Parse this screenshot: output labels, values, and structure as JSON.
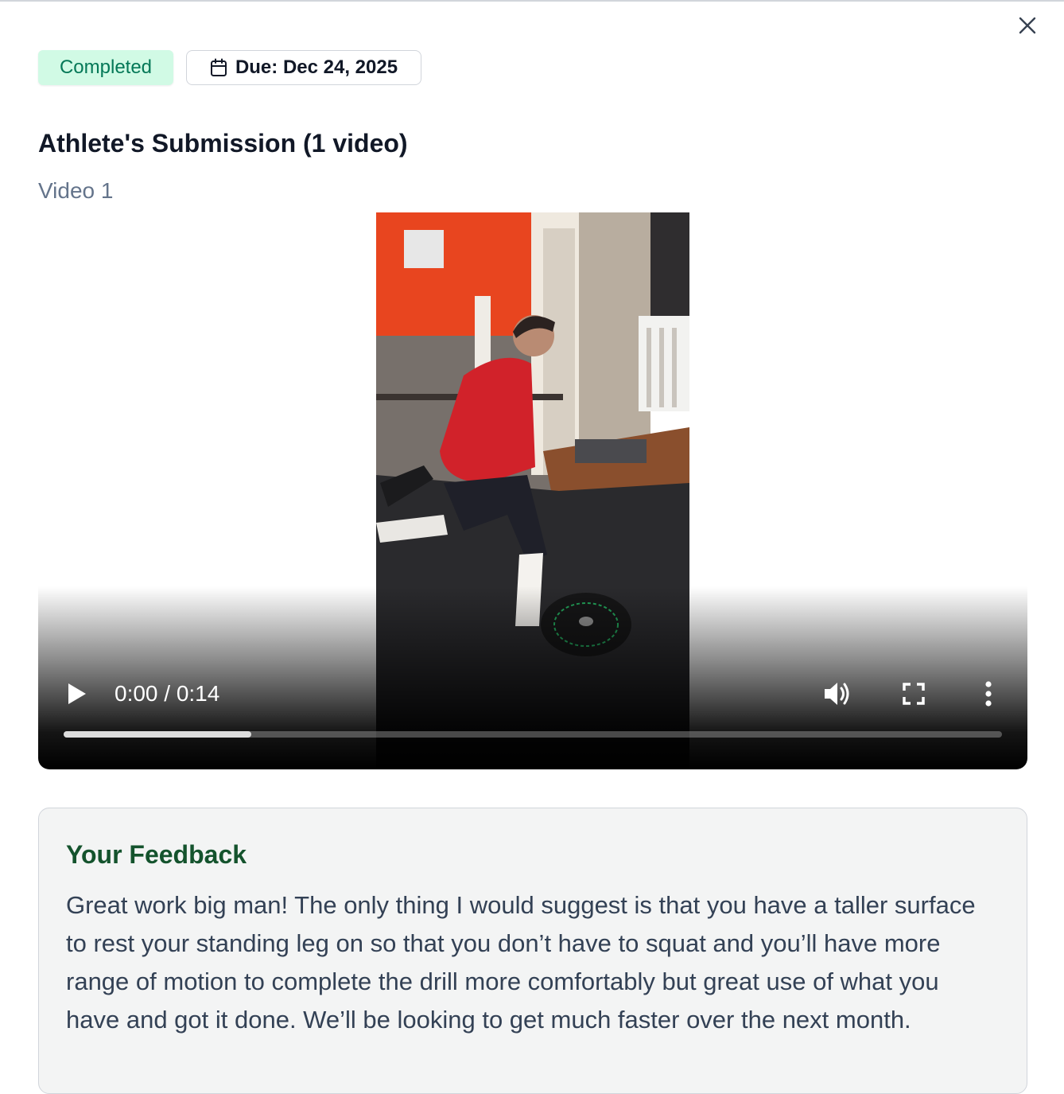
{
  "modal": {
    "status_badge": "Completed",
    "due_label": "Due: Dec 24, 2025",
    "heading": "Athlete's Submission (1 video)",
    "video_label": "Video 1"
  },
  "player": {
    "time": "0:00 / 0:14",
    "progress_fraction": 0.2
  },
  "feedback": {
    "title": "Your Feedback",
    "text": "Great work big man! The only thing I would suggest is that you have a taller surface to rest your standing leg on so that you don’t have to squat and you’ll have more range of motion to complete the drill more comfortably but great use of what you have and got it done. We’ll be looking to get much faster over the next month."
  },
  "icons": [
    "close-icon",
    "calendar-icon",
    "play-icon",
    "volume-icon",
    "fullscreen-icon",
    "more-vert-icon"
  ],
  "colors": {
    "completed_bg": "#d1fae5",
    "completed_text": "#047857",
    "feedback_title": "#14532d",
    "feedback_bg": "#f3f4f4",
    "muted_text": "#64748b"
  }
}
